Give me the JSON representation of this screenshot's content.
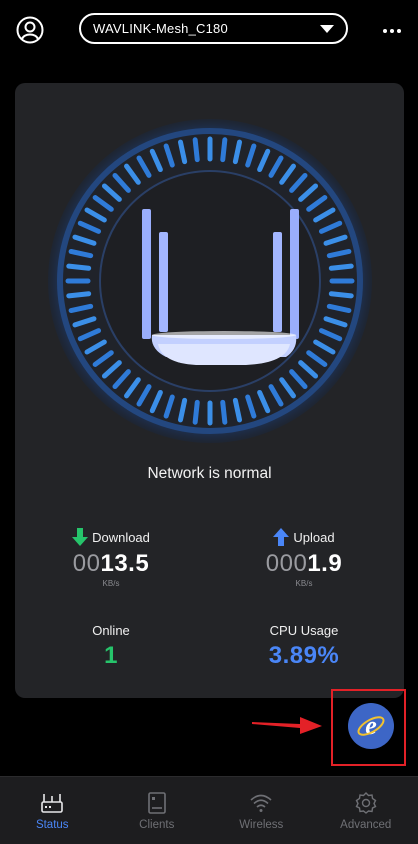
{
  "header": {
    "device_name": "WAVLINK-Mesh_C180"
  },
  "main": {
    "status_message": "Network is normal",
    "download": {
      "label": "Download",
      "value_prefix": "00",
      "value": "13.5",
      "unit": "KB/s"
    },
    "upload": {
      "label": "Upload",
      "value_prefix": "000",
      "value": "1.9",
      "unit": "KB/s"
    },
    "online": {
      "label": "Online",
      "value": "1"
    },
    "cpu": {
      "label": "CPU Usage",
      "value": "3.89%"
    }
  },
  "tabs": [
    {
      "label": "Status",
      "icon": "router-icon",
      "active": true
    },
    {
      "label": "Clients",
      "icon": "clients-icon",
      "active": false
    },
    {
      "label": "Wireless",
      "icon": "wifi-icon",
      "active": false
    },
    {
      "label": "Advanced",
      "icon": "gear-icon",
      "active": false
    }
  ],
  "colors": {
    "accent": "#4a86f7",
    "online": "#26c46b",
    "highlight": "#e32127"
  }
}
